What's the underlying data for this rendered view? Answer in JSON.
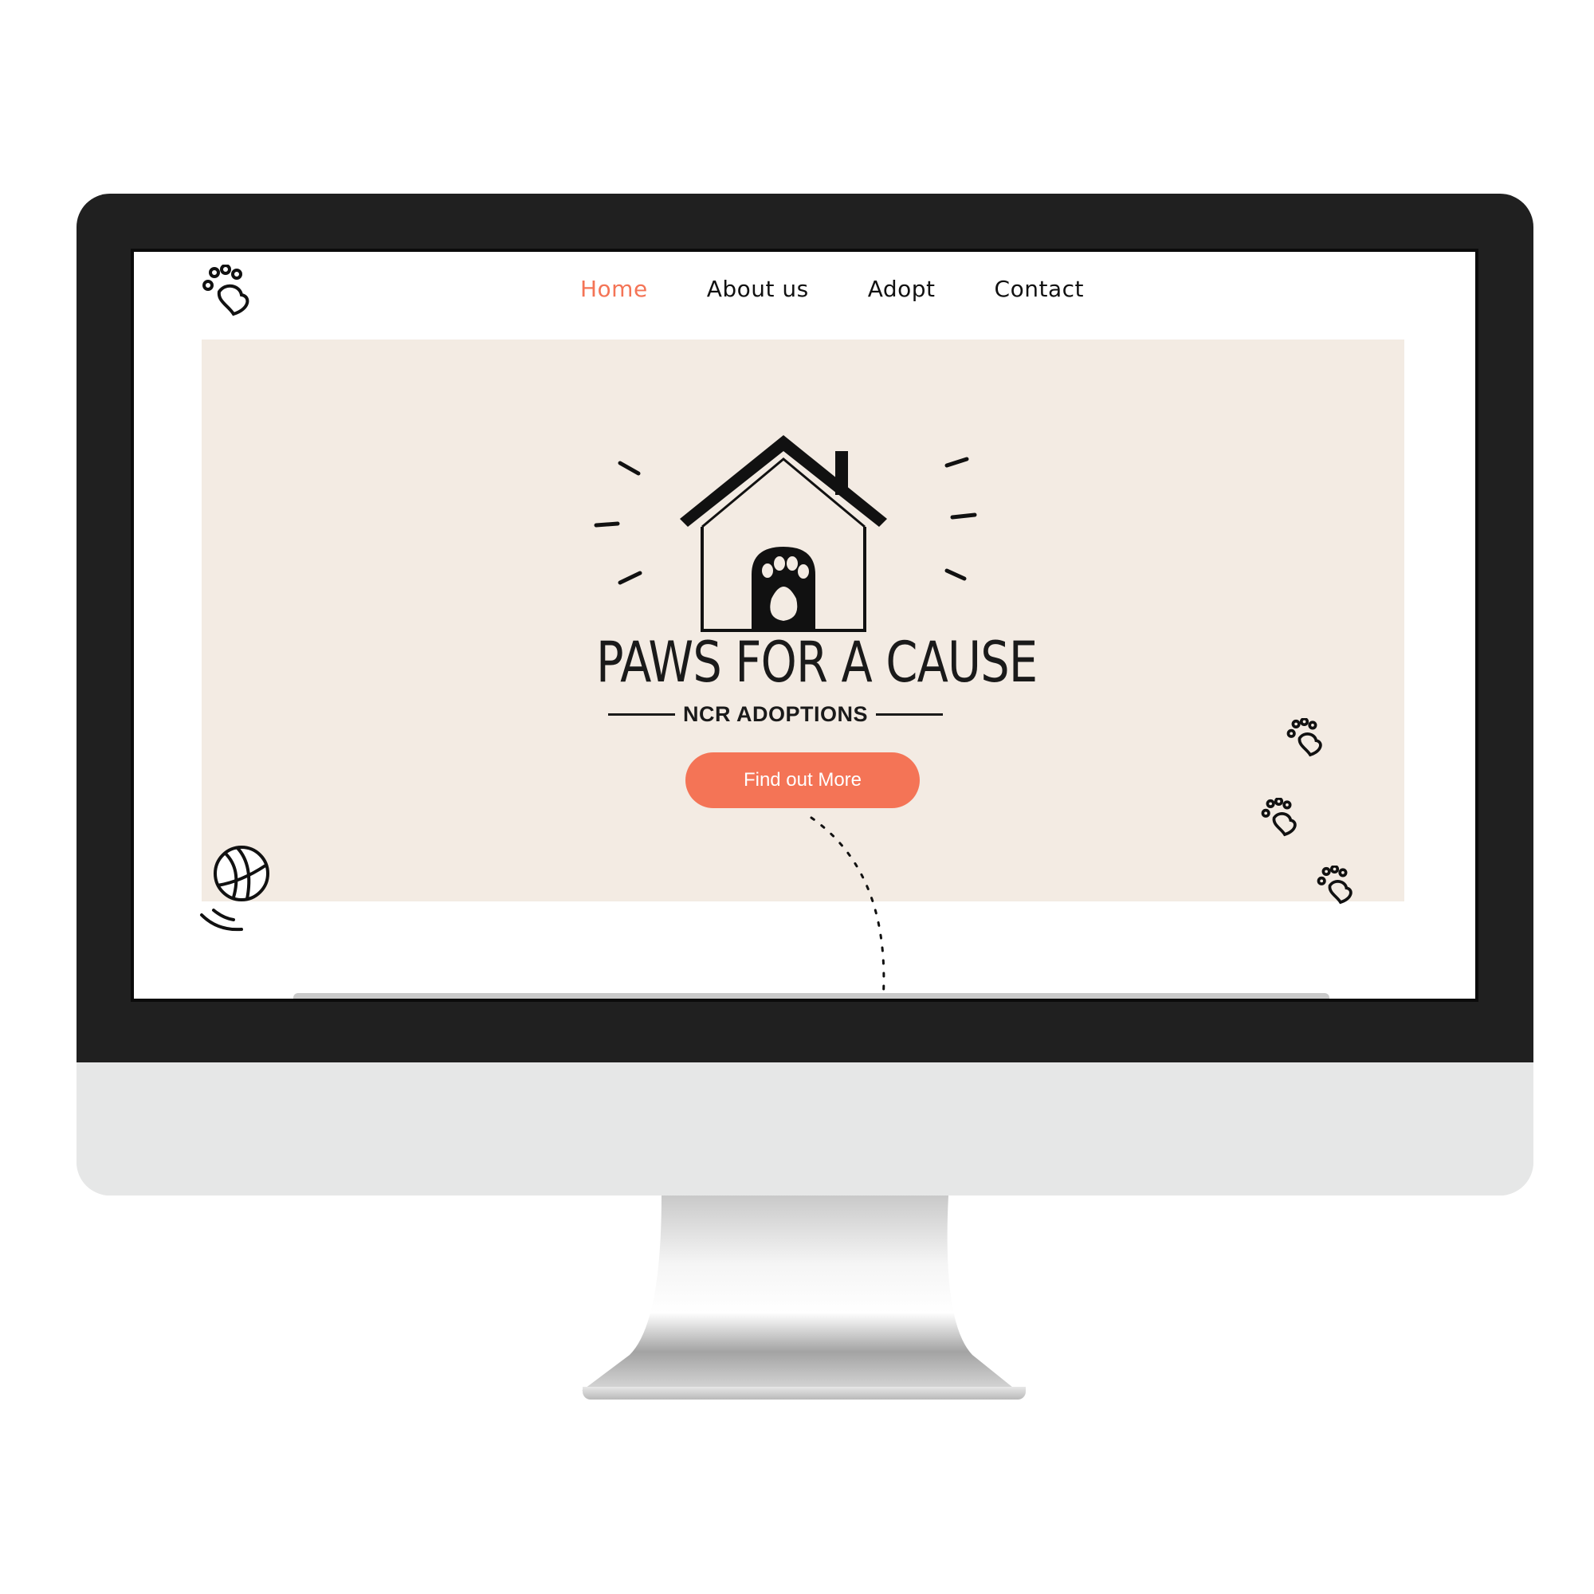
{
  "nav": {
    "items": [
      {
        "label": "Home",
        "active": true
      },
      {
        "label": "About us",
        "active": false
      },
      {
        "label": "Adopt",
        "active": false
      },
      {
        "label": "Contact",
        "active": false
      }
    ]
  },
  "hero": {
    "brand_title": "PAWS FOR A CAUSE",
    "brand_subtitle": "NCR ADOPTIONS",
    "cta_label": "Find out More"
  },
  "colors": {
    "accent": "#f47456",
    "hero_background": "#f3ebe3",
    "text": "#111111",
    "bezel": "#202020"
  },
  "icons": [
    "paw-heart-icon",
    "house-paw-logo",
    "yarn-ball-icon"
  ]
}
